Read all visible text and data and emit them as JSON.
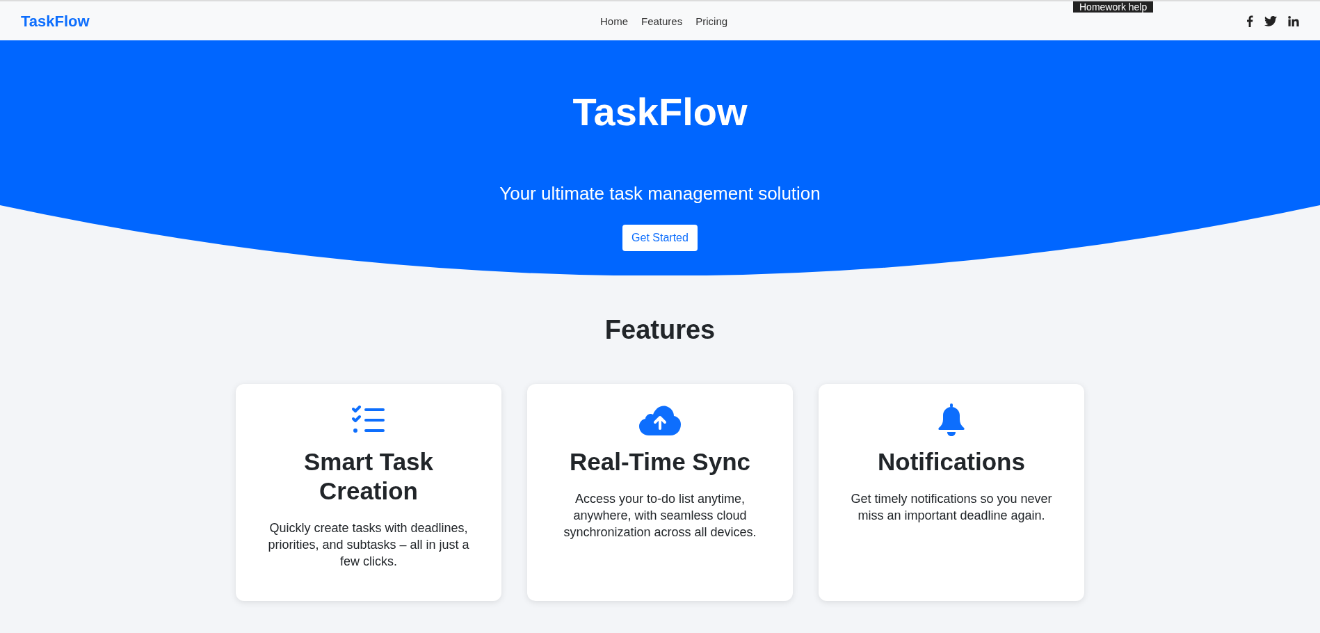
{
  "navbar": {
    "brand": "TaskFlow",
    "links": [
      "Home",
      "Features",
      "Pricing"
    ],
    "social": [
      {
        "kind": "facebook"
      },
      {
        "kind": "twitter"
      },
      {
        "kind": "linkedin"
      }
    ]
  },
  "tooltip": "Homework help",
  "hero": {
    "title": "TaskFlow",
    "subtitle": "Your ultimate task management solution",
    "button": "Get Started"
  },
  "features": {
    "heading": "Features",
    "cards": [
      {
        "title": "Smart Task Creation",
        "description": "Quickly create tasks with deadlines, priorities, and subtasks – all in just a few clicks."
      },
      {
        "title": "Real-Time Sync",
        "description": "Access your to-do list anytime, anywhere, with seamless cloud synchronization across all devices."
      },
      {
        "title": "Notifications",
        "description": "Get timely notifications so you never miss an important deadline again."
      }
    ]
  }
}
